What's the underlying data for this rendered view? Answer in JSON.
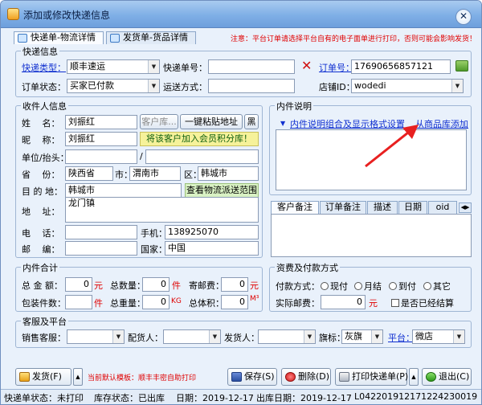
{
  "window": {
    "title": "添加或修改快递信息",
    "close_glyph": "✕"
  },
  "tabs": [
    {
      "label": "快递单-物流详情"
    },
    {
      "label": "发货单-货品详情"
    }
  ],
  "notice": "注意：平台订单请选择平台自有的电子面单进行打印，否则可能会影响发货！",
  "express": {
    "group_title": "快递信息",
    "type_label": "快递类型：",
    "type_value": "顺丰速运",
    "no_label": "快递单号：",
    "no_value": "",
    "order_no_label": "订单号：",
    "order_no_value": "17690656857121",
    "status_label": "订单状态：",
    "status_value": "买家已付款",
    "ship_method_label": "运送方式：",
    "ship_method_value": "",
    "shop_id_label": "店铺ID：",
    "shop_id_value": "wodedi",
    "delete_glyph": "✕"
  },
  "receiver": {
    "group_title": "收件人信息",
    "name_label": "姓　 名：",
    "name_value": "刘振红",
    "customer_lib_btn": "客户库...",
    "paste_btn": "一键粘贴地址",
    "black_btn": "黑",
    "nickname_label": "昵　 称：",
    "nickname_value": "刘振红",
    "join_member_btn": "将该客户加入会员积分库！",
    "company_label": "单位/抬头：",
    "company_value": "",
    "slash": "/",
    "company_value2": "",
    "province_label": "省　 份：",
    "province_value": "陕西省",
    "city_label": "市：",
    "city_value": "渭南市",
    "district_label": "区：",
    "district_value": "韩城市",
    "dest_label": "目 的 地：",
    "dest_value": "韩城市",
    "check_range_btn": "查看物流派送范围",
    "address_label": "地　 址：",
    "address_value": "龙门镇",
    "phone_label": "电　 话：",
    "phone_value": "",
    "mobile_label": "手机：",
    "mobile_value": "138925070",
    "zip_label": "邮　 编：",
    "zip_value": "",
    "country_label": "国家：",
    "country_value": "中国"
  },
  "item_desc": {
    "group_title": "内件说明",
    "dropdown_glyph": "▼",
    "settings_link": "内件说明组合及显示格式设置",
    "from_goods_link": "从商品库添加"
  },
  "remark_tabs": [
    {
      "label": "客户备注"
    },
    {
      "label": "订单备注"
    },
    {
      "label": "描述"
    },
    {
      "label": "日期"
    },
    {
      "label": "oid"
    }
  ],
  "totals": {
    "group_title": "内件合计",
    "amount_label": "总 金 额：",
    "amount_value": "0",
    "amount_unit": "元",
    "qty_label": "总数量：",
    "qty_value": "0",
    "qty_unit": "件",
    "mail_fee_label": "寄邮费：",
    "mail_fee_value": "0",
    "mail_fee_unit": "元",
    "pack_label": "包装件数：",
    "pack_value": "",
    "pack_unit": "件",
    "weight_label": "总重量：",
    "weight_value": "0",
    "weight_unit": "KG",
    "volume_label": "总体积：",
    "volume_value": "0",
    "volume_unit": "M³"
  },
  "payment": {
    "group_title": "资费及付款方式",
    "method_label": "付款方式：",
    "options": [
      {
        "label": "现付"
      },
      {
        "label": "月结"
      },
      {
        "label": "到付"
      },
      {
        "label": "其它"
      }
    ],
    "actual_fee_label": "实际邮费：",
    "actual_fee_value": "0",
    "actual_fee_unit": "元",
    "settled_label": "是否已经结算"
  },
  "service": {
    "group_title": "客服及平台",
    "sales_label": "销售客服：",
    "sales_value": "",
    "picker_label": "配货人：",
    "picker_value": "",
    "shipper_label": "发货人：",
    "shipper_value": "",
    "flag_label": "旗标：",
    "flag_value": "灰旗",
    "platform_label": "平台：",
    "platform_value": "微店"
  },
  "actions": {
    "ship_btn": "发货(F)",
    "up_glyph": "▲",
    "default_template_note": "当前默认模板：顺丰丰密自助打印",
    "save_btn": "保存(S)",
    "delete_btn": "删除(D)",
    "print_btn": "打印快递单(P)",
    "exit_btn": "退出(C)"
  },
  "statusbar": {
    "express_status": "快递单状态：未打印",
    "stock_status": "库存状态：已出库",
    "date": "日期：2019-12-17",
    "out_date": "出库日期：2019-12-17",
    "code": "L042201912171224230019"
  },
  "colors": {
    "accent": "#1030d0",
    "warn": "#e00000",
    "arrow": "#e82020"
  }
}
